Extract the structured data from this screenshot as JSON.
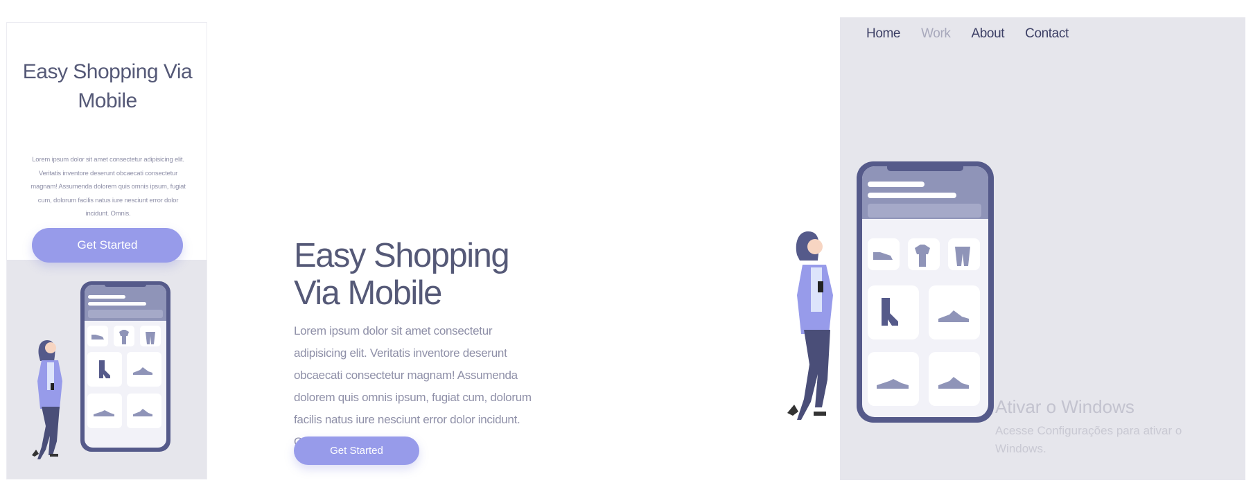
{
  "mobile_preview": {
    "title": "Easy Shopping Via Mobile",
    "description": "Lorem ipsum dolor sit amet consectetur adipisicing elit. Veritatis inventore deserunt obcaecati consectetur magnam! Assumenda dolorem quis omnis ipsum, fugiat cum, dolorum facilis natus iure nesciunt error dolor incidunt. Omnis.",
    "cta_label": "Get Started"
  },
  "hero": {
    "title_line1": "Easy Shopping",
    "title_line2": "Via Mobile",
    "description": "Lorem ipsum dolor sit amet consectetur adipisicing elit. Veritatis inventore deserunt obcaecati consectetur magnam! Assumenda dolorem quis omnis ipsum, fugiat cum, dolorum facilis natus iure nesciunt error dolor incidunt. Omnis.",
    "cta_label": "Get Started"
  },
  "nav": {
    "items": [
      {
        "label": "Home",
        "active": false
      },
      {
        "label": "Work",
        "active": true
      },
      {
        "label": "About",
        "active": false
      },
      {
        "label": "Contact",
        "active": false
      }
    ]
  },
  "illustration": {
    "icons": [
      "shoe-flat-icon",
      "tshirt-icon",
      "pants-icon",
      "boot-icon",
      "sneaker-icon",
      "sneaker-icon",
      "sneaker-icon"
    ]
  },
  "windows_watermark": {
    "title": "Ativar o Windows",
    "subtitle": "Acesse Configurações para ativar o Windows."
  },
  "colors": {
    "accent": "#979bea",
    "text_dark": "#555977",
    "text_muted": "#8f90a8",
    "panel_bg": "#e6e6ec",
    "phone_frame": "#555a8a",
    "phone_header": "#8f94b8"
  }
}
